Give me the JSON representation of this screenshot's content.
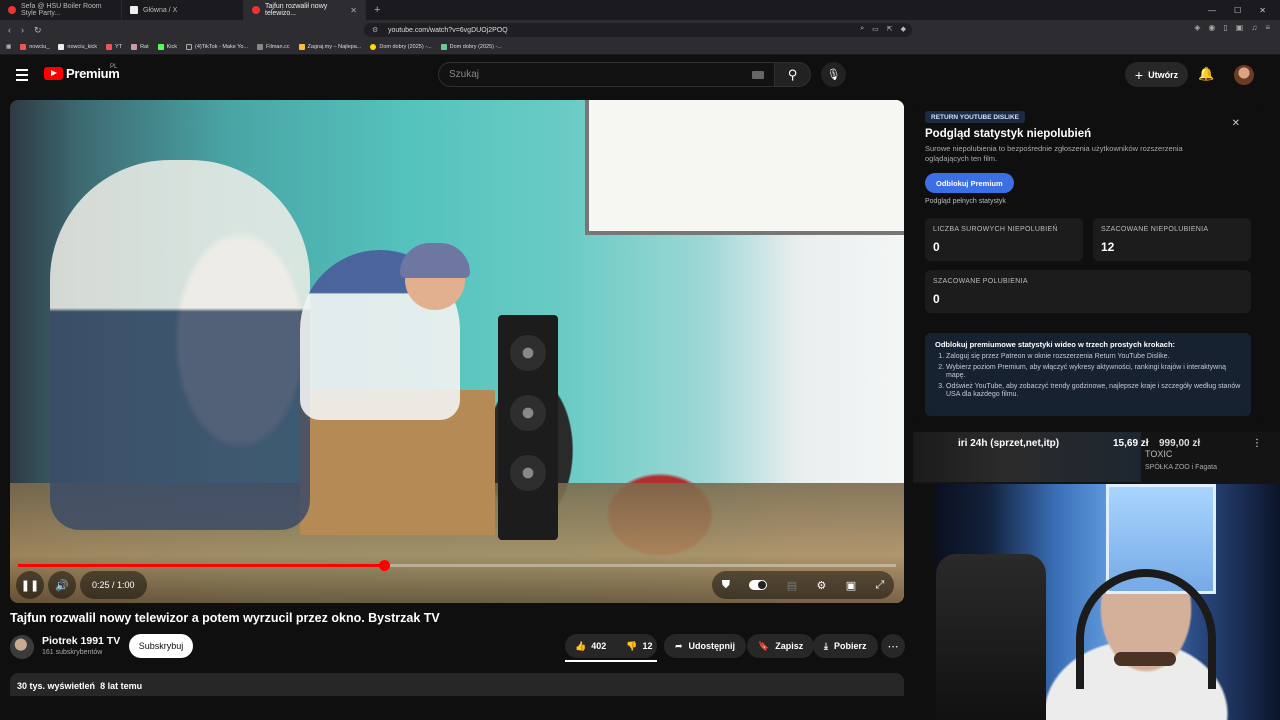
{
  "browser": {
    "tabs": [
      {
        "label": "Sefa @ HSU Boiler Room Style Party...",
        "active": false,
        "favicon": "youtube-icon"
      },
      {
        "label": "Główna / X",
        "active": false,
        "favicon": "x-icon"
      },
      {
        "label": "Tajfun rozwalił nowy telewizo...",
        "active": true,
        "favicon": "youtube-icon"
      }
    ],
    "url": "youtube.com/watch?v=6vgDUOj2POQ",
    "bookmarks": [
      "nowciu_",
      "nowciu_kick",
      "YT",
      "Rat",
      "Kick",
      "(4)TikTok - Make Yo...",
      "Filman.cc",
      "Zagraj.my – Najlepa...",
      "Dom dobry (2025) -...",
      "Dom dobry (2025) -..."
    ]
  },
  "header": {
    "logo_text": "Premium",
    "logo_region": "PL",
    "search_placeholder": "Szukaj",
    "create_label": "Utwórz"
  },
  "player": {
    "progress": 0.4167,
    "time": "0:25 / 1:00",
    "state": "playing"
  },
  "video": {
    "title": "Tajfun rozwalil nowy telewizor a potem wyrzucil przez okno. Bystrzak TV",
    "channel": "Piotrek 1991 TV",
    "subscribers": "161 subskrybentów",
    "subscribe_label": "Subskrybuj",
    "likes": "402",
    "dislikes": "12",
    "share_label": "Udostępnij",
    "save_label": "Zapisz",
    "download_label": "Pobierz",
    "views": "30 tys. wyświetleń",
    "age": "8 lat temu"
  },
  "ryd": {
    "badge": "RETURN YOUTUBE DISLIKE",
    "title": "Podgląd statystyk niepolubień",
    "subtitle": "Surowe niepolubienia to bezpośrednie zgłoszenia użytkowników rozszerzenia oglądających ten film.",
    "unlock_label": "Odblokuj Premium",
    "full_stats": "Podgląd pełnych statystyk",
    "stats": [
      {
        "label": "LICZBA SUROWYCH NIEPOLUBIEŃ",
        "value": "0"
      },
      {
        "label": "SZACOWANE NIEPOLUBIENIA",
        "value": "12"
      },
      {
        "label": "SZACOWANE POLUBIENIA",
        "value": "0"
      }
    ],
    "steps_title": "Odblokuj premiumowe statystyki wideo w trzech prostych krokach:",
    "steps": [
      "Zaloguj się przez Patreon w oknie rozszerzenia Return YouTube Dislike.",
      "Wybierz poziom Premium, aby włączyć wykresy aktywności, rankingi krajów i interaktywną mapę.",
      "Odśwież YouTube, aby zobaczyć trendy godzinowe, najlepsze kraje i szczegóły według stanów USA dla każdego filmu."
    ]
  },
  "recommendation": {
    "thumb_text": "iri 24h (sprzet,net,itp)",
    "price1": "15,69 zł",
    "price2": "999,00 zł",
    "title": "TOXIC",
    "channel": "SPÓŁKA ZOO i Fagata"
  }
}
